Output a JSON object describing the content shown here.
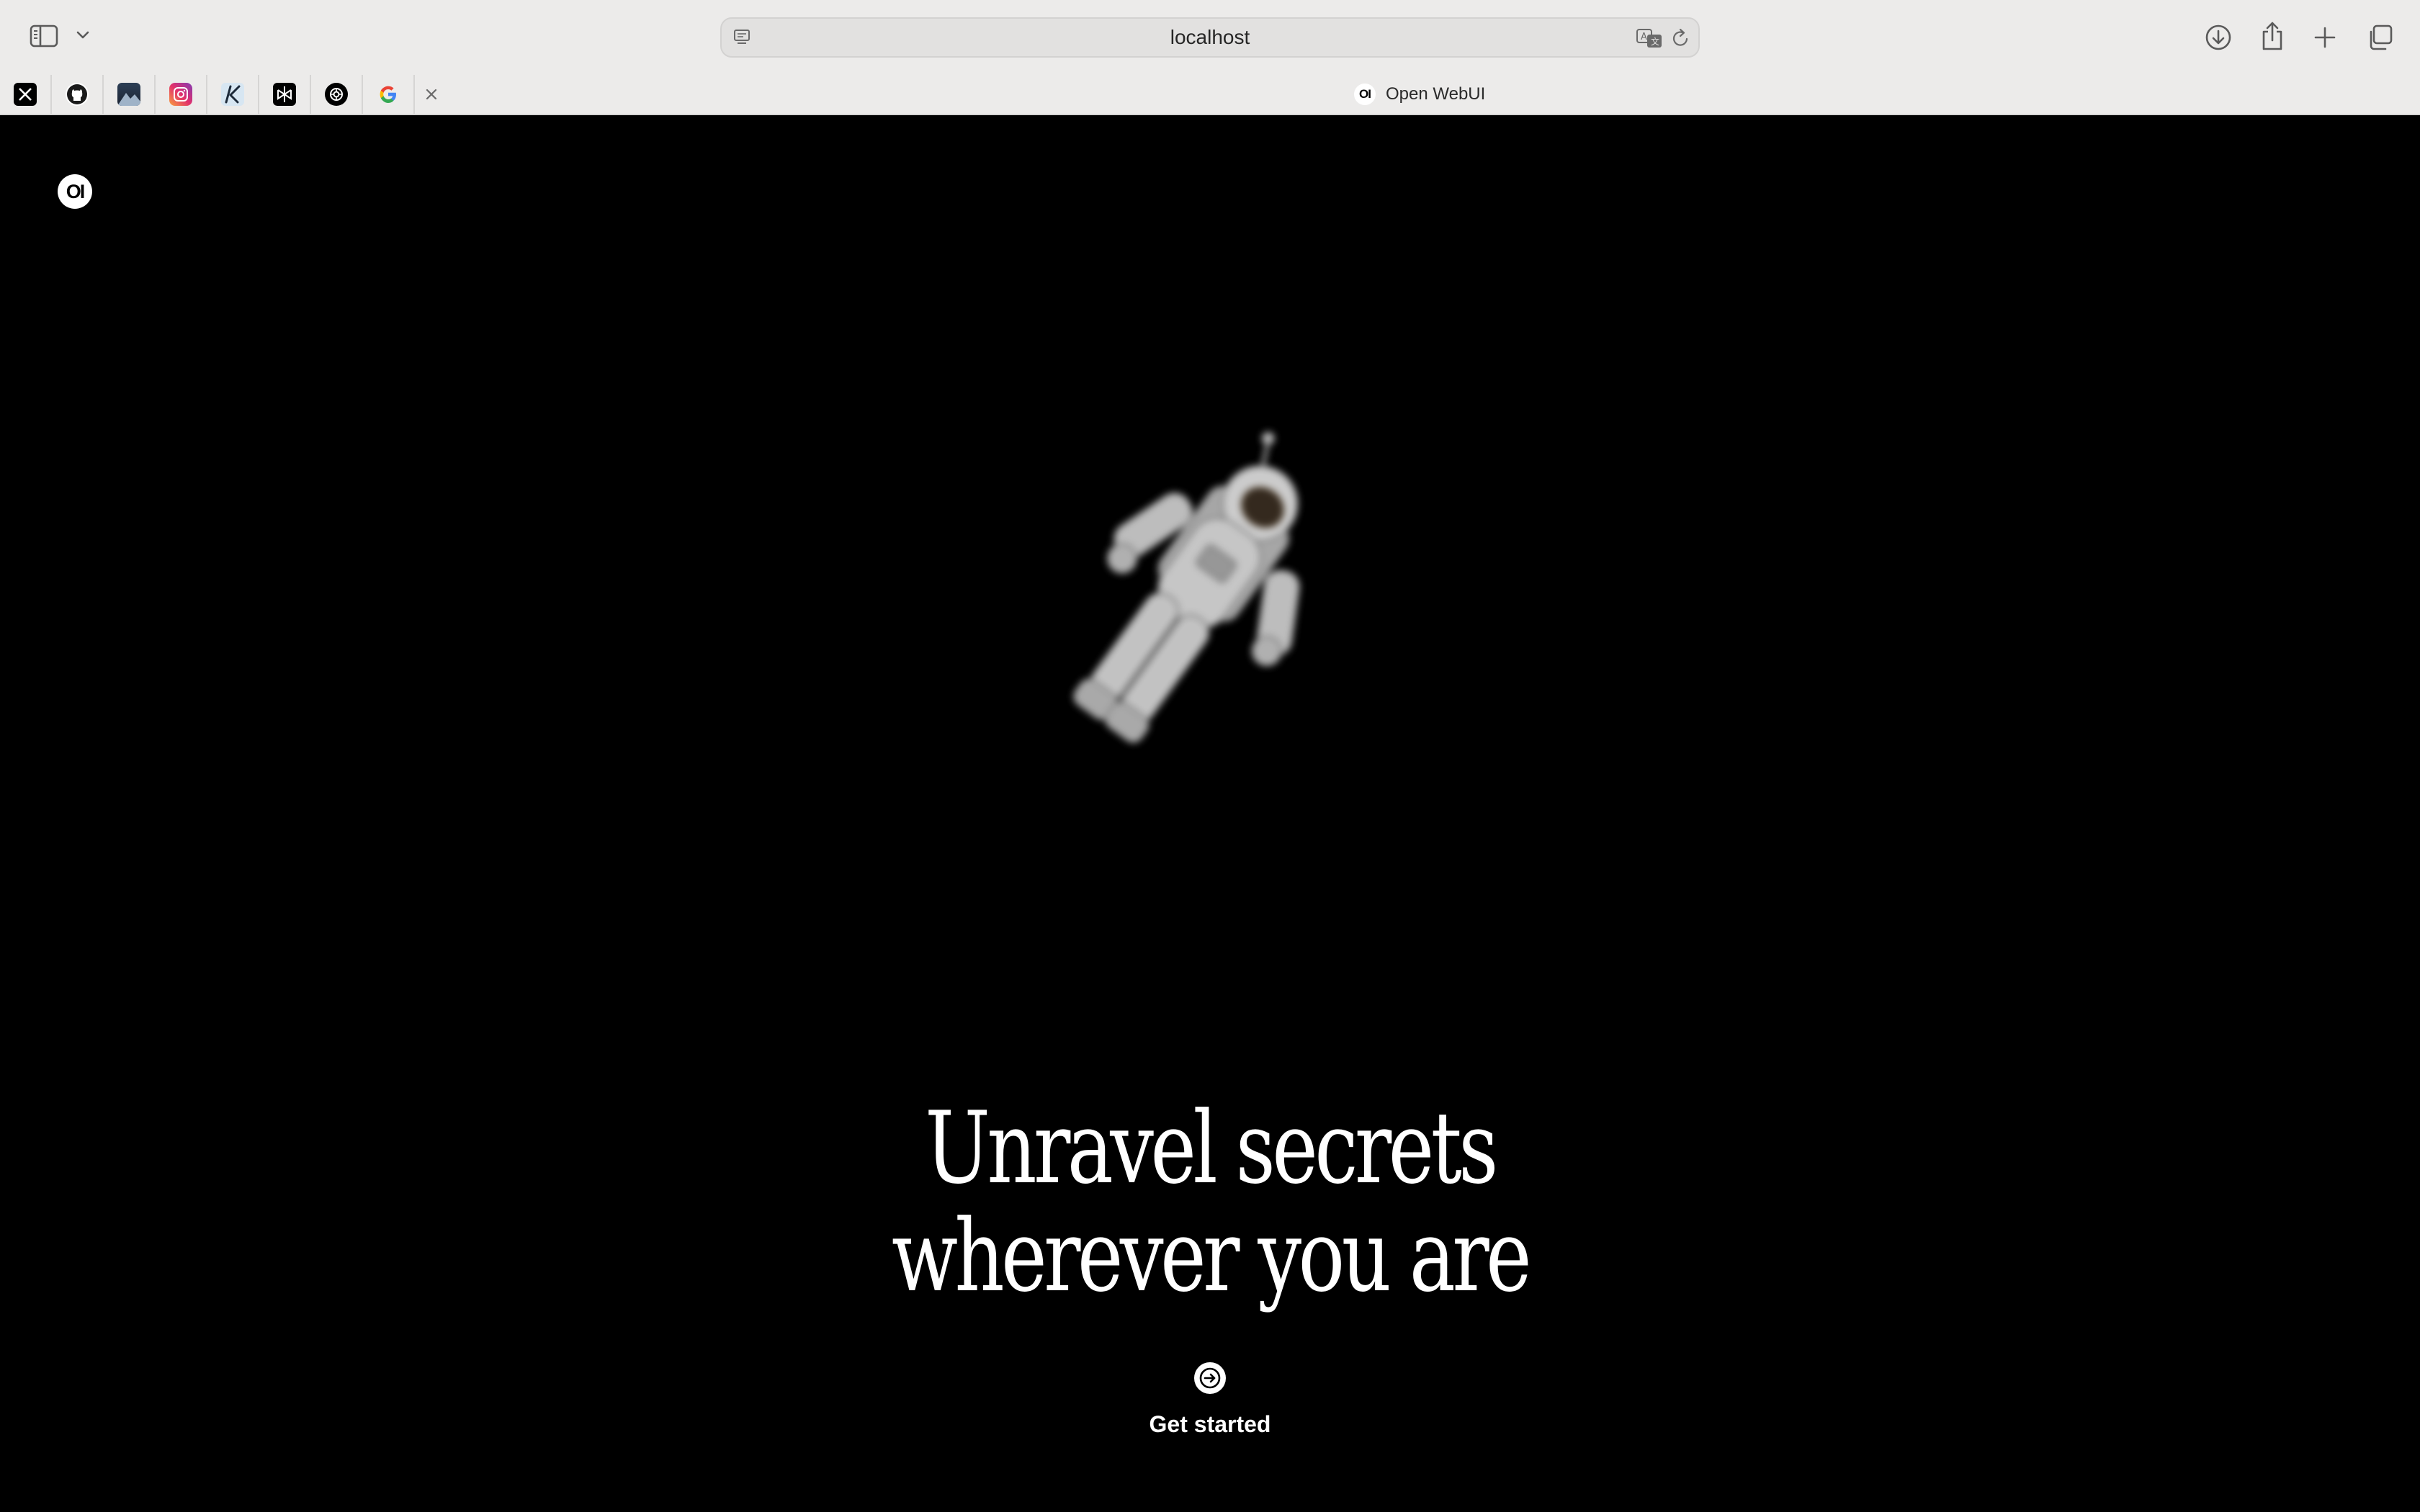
{
  "browser": {
    "address_bar": {
      "url": "localhost"
    },
    "tab_bar": {
      "pinned_tabs": [
        {
          "icon": "x-twitter-icon"
        },
        {
          "icon": "github-icon"
        },
        {
          "icon": "landscape-photo-icon"
        },
        {
          "icon": "instagram-icon"
        },
        {
          "icon": "k-logo-icon"
        },
        {
          "icon": "perplexity-icon"
        },
        {
          "icon": "openai-icon"
        },
        {
          "icon": "google-icon"
        }
      ],
      "active_tab": {
        "favicon_text": "OI",
        "title": "Open WebUI"
      }
    }
  },
  "page": {
    "logo_text": "OI",
    "hero_image": "astronaut-illustration",
    "headline": {
      "line1": "Unravel secrets",
      "line2": "wherever you are"
    },
    "cta": {
      "icon": "arrow-right-circle-icon",
      "label": "Get started"
    }
  },
  "colors": {
    "chrome_background": "#ecebea",
    "page_background": "#000000",
    "text_primary": "#ffffff"
  }
}
